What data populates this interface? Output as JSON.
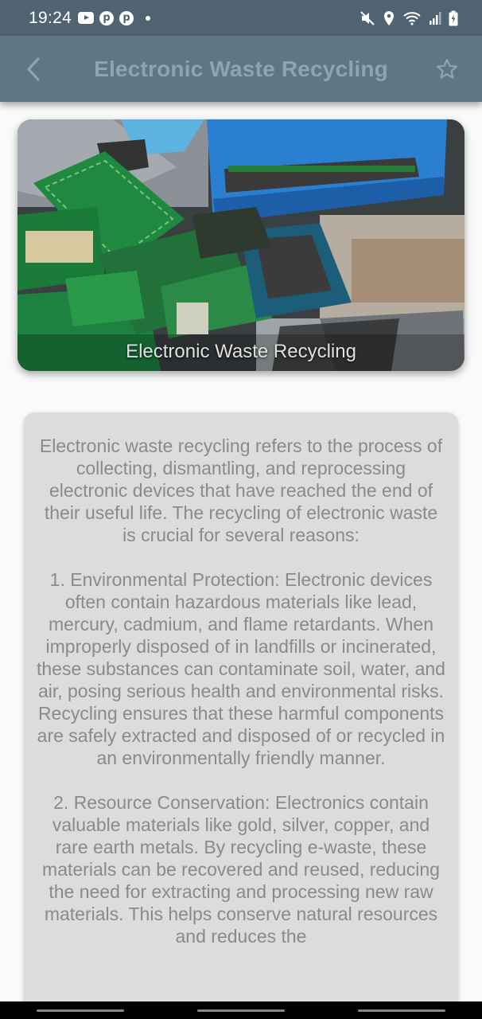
{
  "status_bar": {
    "time": "19:24",
    "left_icons": [
      "youtube-icon",
      "pinterest-icon",
      "pinterest-icon",
      "dot-icon"
    ],
    "right_icons": [
      "mute-icon",
      "location-icon",
      "wifi-icon",
      "signal-icon",
      "battery-icon"
    ]
  },
  "app_bar": {
    "title": "Electronic Waste Recycling",
    "back_icon": "chevron-left-icon",
    "favorite_icon": "star-outline-icon",
    "background_color": "#5e7785",
    "title_color": "#8fa4b0"
  },
  "hero": {
    "caption": "Electronic Waste Recycling",
    "image_subject": "circuit boards and blue crate"
  },
  "article": {
    "paragraphs": [
      "Electronic waste recycling refers to the process of collecting, dismantling, and reprocessing electronic devices that have reached the end of their useful life. The recycling of electronic waste is crucial for several reasons:",
      "1. Environmental Protection: Electronic devices often contain hazardous materials like lead, mercury, cadmium, and flame retardants. When improperly disposed of in landfills or incinerated, these substances can contaminate soil, water, and air, posing serious health and environmental risks. Recycling ensures that these harmful components are safely extracted and disposed of or recycled in an environmentally friendly manner.",
      "2. Resource Conservation: Electronics contain valuable materials like gold, silver, copper, and rare earth metals. By recycling e-waste, these materials can be recovered and reused, reducing the need for extracting and processing new raw materials. This helps conserve natural resources and reduces the"
    ]
  }
}
